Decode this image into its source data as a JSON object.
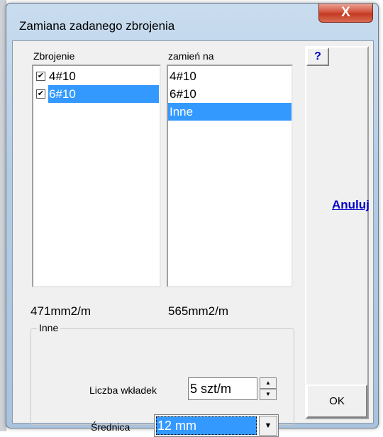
{
  "window": {
    "title": "Zamiana zadanego zbrojenia",
    "close_label": "X"
  },
  "left_list": {
    "header": "Zbrojenie",
    "items": [
      {
        "checked": true,
        "check_mark": "✔",
        "label": "4#10",
        "selected": false
      },
      {
        "checked": true,
        "check_mark": "✔",
        "label": "6#10",
        "selected": true
      }
    ],
    "total": "471mm2/m"
  },
  "right_list": {
    "header": "zamień na",
    "items": [
      {
        "label": "4#10",
        "selected": false
      },
      {
        "label": "6#10",
        "selected": false
      },
      {
        "label": "Inne",
        "selected": true
      }
    ],
    "total": "565mm2/m"
  },
  "group": {
    "legend": "Inne",
    "count_label": "Liczba wkładek",
    "count_value": "5 szt/m",
    "diameter_label": "Średnica",
    "diameter_value": "12 mm"
  },
  "side": {
    "help_label": "?",
    "cancel_label": "Anuluj",
    "ok_label": "OK"
  },
  "icons": {
    "spin_up": "▲",
    "spin_down": "▼",
    "combo_arrow": "▼"
  },
  "colors": {
    "selection": "#3399ff",
    "link": "#0000cc",
    "close_button": "#c43a22"
  }
}
